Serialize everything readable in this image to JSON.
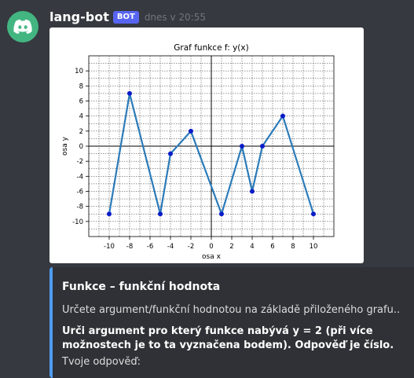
{
  "message": {
    "username": "lang-bot",
    "badge": "BOT",
    "timestamp": "dnes v 20:55",
    "avatar_icon": "discord-logo-icon",
    "avatar_color": "#43b581"
  },
  "embed": {
    "accent_color": "#4f9cf0",
    "title": "Funkce – funkční hodnota",
    "description": "Určete argument/funkční hodnotou na základě přiloženého grafu..",
    "question": "Urči argument pro který funkce nabývá y = 2 (při více možnostech je to ta vyznačena bodem). Odpověď je číslo.",
    "prompt": "Tvoje odpověď:"
  },
  "chart_data": {
    "type": "line",
    "title": "Graf funkce f: y(x)",
    "xlabel": "osa x",
    "ylabel": "osa y",
    "xlim": [
      -12,
      12
    ],
    "ylim": [
      -12,
      12
    ],
    "xticks": [
      -10,
      -8,
      -6,
      -4,
      -2,
      0,
      2,
      4,
      6,
      8,
      10
    ],
    "yticks": [
      -10,
      -8,
      -6,
      -4,
      -2,
      0,
      2,
      4,
      6,
      8,
      10
    ],
    "grid": true,
    "line_color": "#2b7bb9",
    "marker_color": "#0a1cc8",
    "x": [
      -10,
      -8,
      -5,
      -4,
      -2,
      1,
      3,
      4,
      5,
      7,
      10
    ],
    "y": [
      -9,
      7,
      -9,
      -1,
      2,
      -9,
      0,
      -6,
      0,
      4,
      -9
    ]
  }
}
